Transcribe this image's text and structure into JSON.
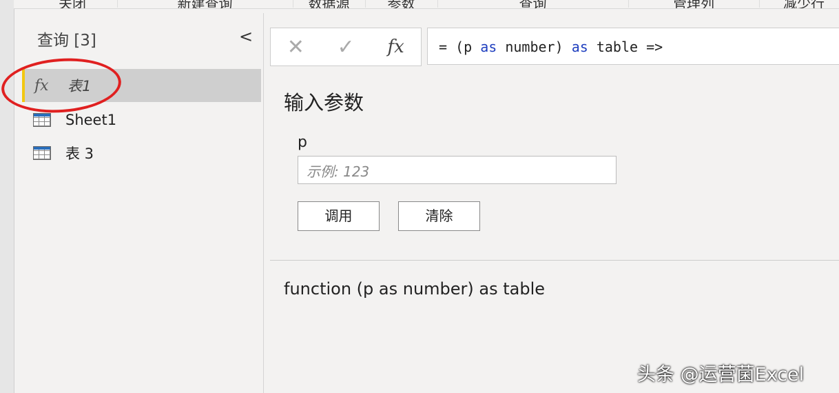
{
  "ribbon": [
    "关闭",
    "新建查询",
    "数据源",
    "参数",
    "查询",
    "管理列",
    "减少行"
  ],
  "sidebar": {
    "title": "查询 [3]",
    "collapse_icon": "chevron-left",
    "items": [
      {
        "label": "表1",
        "icon": "fx"
      },
      {
        "label": "Sheet1",
        "icon": "table"
      },
      {
        "label": "表 3",
        "icon": "table"
      }
    ]
  },
  "formula": {
    "cancel": "✕",
    "confirm": "✓",
    "fx": "fx",
    "p1": "= (p ",
    "as1": "as",
    "p2": " number) ",
    "as2": "as",
    "p3": " table =>"
  },
  "main": {
    "heading": "输入参数",
    "param_label": "p",
    "param_placeholder": "示例: 123",
    "invoke": "调用",
    "clear": "清除",
    "signature": "function (p as number) as table"
  },
  "watermark": "头条 @运营菌Excel",
  "colors": {
    "selected_accent": "#f2c811",
    "annotation": "#e02020",
    "keyword": "#1f3fbf"
  }
}
